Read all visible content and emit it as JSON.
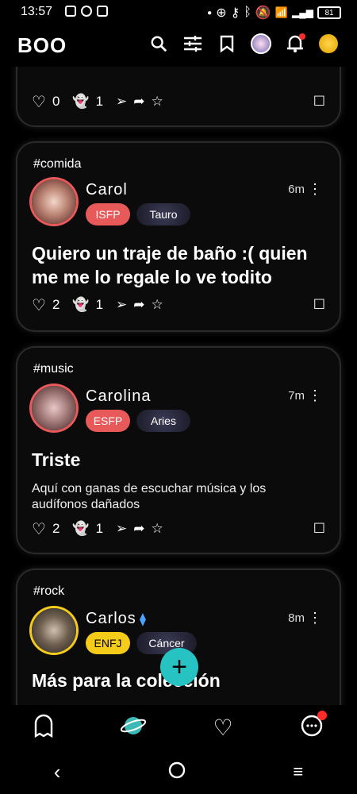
{
  "status": {
    "time": "13:57",
    "battery": "81"
  },
  "app": {
    "logo": "BOO"
  },
  "posts": [
    {
      "likes": "0",
      "ghosts": "1"
    },
    {
      "tag": "#comida",
      "name": "Carol",
      "time": "6m",
      "type": "ISFP",
      "type_color": "#e85a5a",
      "sign": "Tauro",
      "title": "Quiero un traje de baño :( quien me  me lo regale lo ve todito",
      "body": "",
      "likes": "2",
      "ghosts": "1"
    },
    {
      "tag": "#music",
      "name": "Carolina",
      "time": "7m",
      "type": "ESFP",
      "type_color": "#e85a5a",
      "sign": "Aries",
      "title": "Triste",
      "body": "Aquí con ganas de escuchar música y los audífonos dañados",
      "likes": "2",
      "ghosts": "1"
    },
    {
      "tag": "#rock",
      "name": "Carlos",
      "time": "8m",
      "type": "ENFJ",
      "type_color": "#f5cc1a",
      "sign": "Cáncer",
      "title": "Más para la colección",
      "body": ""
    }
  ]
}
